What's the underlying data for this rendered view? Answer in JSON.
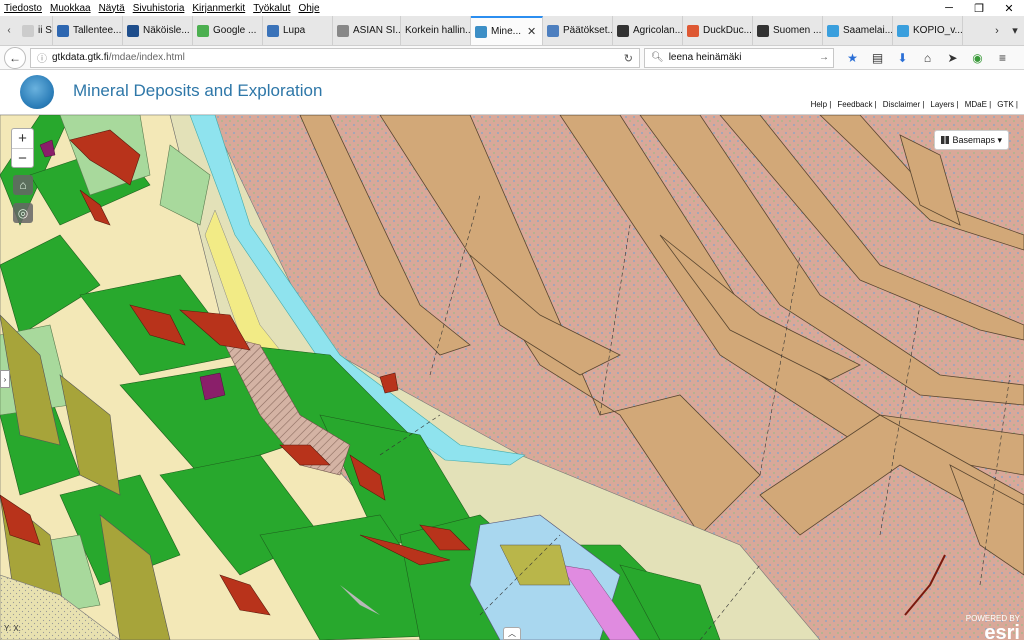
{
  "menu": [
    "Tiedosto",
    "Muokkaa",
    "Näytä",
    "Sivuhistoria",
    "Kirjanmerkit",
    "Työkalut",
    "Ohje"
  ],
  "tabs": [
    {
      "label": "ii S...",
      "color": "#cccccc"
    },
    {
      "label": "Tallentee...",
      "color": "#2e67b1"
    },
    {
      "label": "Näköisle...",
      "color": "#1f4e8c"
    },
    {
      "label": "Google ...",
      "color": "#4caf50"
    },
    {
      "label": "Lupa",
      "color": "#3b73b9"
    },
    {
      "label": "ASIAN SI...",
      "color": "#888888"
    },
    {
      "label": "Korkein hallin...",
      "color": "#aaaaaa"
    },
    {
      "label": "Mine...",
      "color": "#3d8fc6",
      "active": true
    },
    {
      "label": "Päätökset...",
      "color": "#4d7fbf"
    },
    {
      "label": "Agricolan...",
      "color": "#333333"
    },
    {
      "label": "DuckDuc...",
      "color": "#de5833"
    },
    {
      "label": "Suomen ...",
      "color": "#333333"
    },
    {
      "label": "Saamelai...",
      "color": "#3a9fdd"
    },
    {
      "label": "KOPIO_v...",
      "color": "#3a9fdd"
    }
  ],
  "url": {
    "host": "gtkdata.gtk.fi",
    "path": "/mdae/index.html"
  },
  "search": {
    "value": "leena heinämäki"
  },
  "app": {
    "title": "Mineral Deposits and Exploration"
  },
  "toplinks": [
    "Help |",
    "Feedback |",
    "Disclaimer |",
    "Layers |",
    "MDaE |",
    "GTK |"
  ],
  "map": {
    "zoom_in": "+",
    "zoom_out": "−",
    "basemaps_label": "Basemaps ▾",
    "coords": "Y: X:",
    "attribution_small": "POWERED BY",
    "attribution_logo": "esri"
  }
}
